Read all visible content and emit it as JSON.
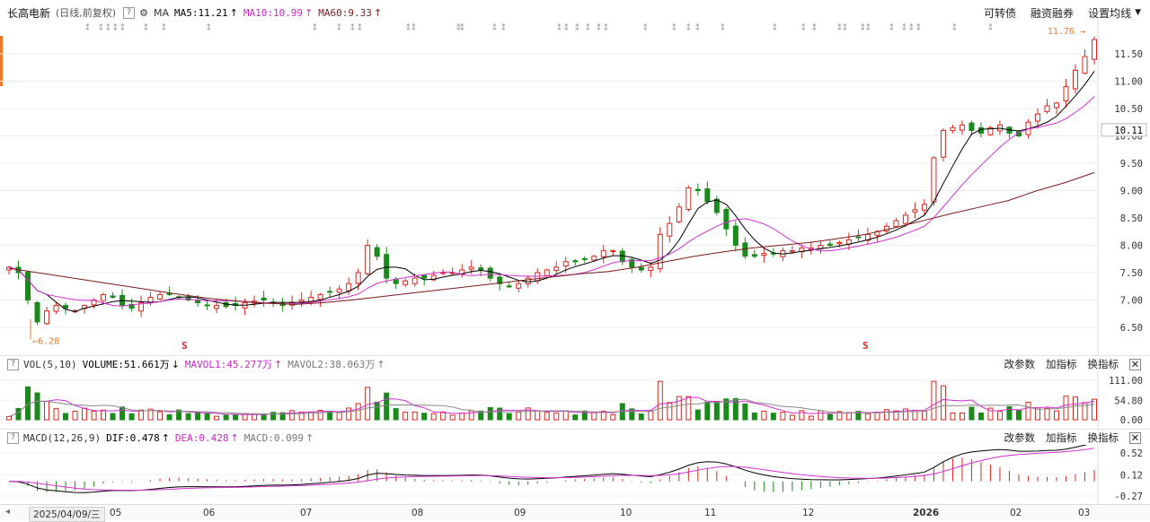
{
  "header": {
    "stock_name": "长高电新",
    "period": "(日线,前复权)",
    "help_icon": "?",
    "settings_icon": "gear-icon",
    "ma_label": "MA",
    "ma5": "MA5:11.21",
    "ma10": "MA10:10.99",
    "ma60": "MA60:9.33",
    "menu": [
      "可转债",
      "融资融券",
      "设置均线"
    ]
  },
  "volume_panel": {
    "indicator": "VOL(5,10)",
    "volume": "VOLUME:51.661万",
    "mavol1": "MAVOL1:45.277万",
    "mavol2": "MAVOL2:38.063万",
    "menu": [
      "改参数",
      "加指标",
      "换指标"
    ]
  },
  "macd_panel": {
    "indicator": "MACD(12,26,9)",
    "dif": "DIF:0.478",
    "dea": "DEA:0.428",
    "macd": "MACD:0.099",
    "menu": [
      "改参数",
      "加指标",
      "换指标"
    ]
  },
  "x_axis": {
    "date_box": "2025/04/09/三",
    "labels": [
      "05",
      "06",
      "07",
      "08",
      "09",
      "10",
      "11",
      "12",
      "2026",
      "02",
      "03"
    ]
  },
  "colors": {
    "up": "#d9261c",
    "down": "#1a8a1a",
    "ma5": "#000000",
    "ma10": "#d22fd2",
    "ma60": "#7a1b1b",
    "accent": "#f07a2a"
  },
  "chart_data": [
    {
      "type": "candlestick",
      "title": "长高电新 (日线,前复权)",
      "y_ticks": [
        "11.50",
        "11.00",
        "10.50",
        "10.00",
        "9.50",
        "9.00",
        "8.50",
        "8.00",
        "7.50",
        "7.00",
        "6.50"
      ],
      "current_price_label": "10.11",
      "annotations": {
        "high": "11.76",
        "low": "6.28"
      },
      "series_close": [
        7.6,
        7.5,
        7.0,
        6.6,
        6.8,
        6.9,
        6.85,
        6.8,
        6.9,
        7.0,
        7.1,
        7.05,
        6.9,
        6.85,
        6.95,
        7.05,
        7.1,
        7.1,
        7.05,
        7.0,
        6.95,
        6.9,
        6.9,
        6.88,
        6.9,
        6.95,
        6.98,
        7.0,
        6.95,
        6.9,
        6.95,
        7.0,
        7.05,
        7.1,
        7.15,
        7.2,
        7.3,
        7.5,
        8.0,
        7.8,
        7.4,
        7.3,
        7.35,
        7.4,
        7.4,
        7.45,
        7.5,
        7.5,
        7.55,
        7.6,
        7.55,
        7.4,
        7.3,
        7.25,
        7.3,
        7.4,
        7.5,
        7.55,
        7.6,
        7.7,
        7.7,
        7.75,
        7.8,
        7.9,
        7.9,
        7.7,
        7.6,
        7.55,
        7.6,
        8.2,
        8.4,
        8.7,
        9.05,
        9.0,
        8.8,
        8.6,
        8.3,
        8.0,
        7.8,
        7.8,
        7.85,
        7.85,
        7.9,
        7.9,
        7.95,
        7.95,
        8.0,
        8.0,
        8.05,
        8.1,
        8.15,
        8.2,
        8.25,
        8.35,
        8.45,
        8.55,
        8.65,
        8.75,
        9.6,
        10.1,
        10.15,
        10.2,
        10.1,
        10.05,
        10.15,
        10.2,
        10.05,
        10.0,
        10.25,
        10.4,
        10.55,
        10.6,
        10.9,
        11.2,
        11.45,
        11.76
      ],
      "ma60_series": [
        7.58,
        7.5,
        7.42,
        7.34,
        7.26,
        7.18,
        7.1,
        7.03,
        6.98,
        6.94,
        6.92,
        6.95,
        7.0,
        7.06,
        7.12,
        7.18,
        7.24,
        7.3,
        7.36,
        7.42,
        7.48,
        7.52,
        7.6,
        7.7,
        7.8,
        7.88,
        7.95,
        8.0,
        8.05,
        8.12,
        8.2,
        8.32,
        8.45,
        8.58,
        8.7,
        8.82,
        9.0,
        9.15,
        9.33
      ],
      "volume": {
        "y_ticks": [
          "111.00",
          "54.80",
          "0.00"
        ],
        "max": 111
      },
      "macd": {
        "y_ticks": [
          "0.52",
          "0.12",
          "-0.27"
        ],
        "ylim": [
          -0.35,
          0.6
        ]
      }
    }
  ]
}
